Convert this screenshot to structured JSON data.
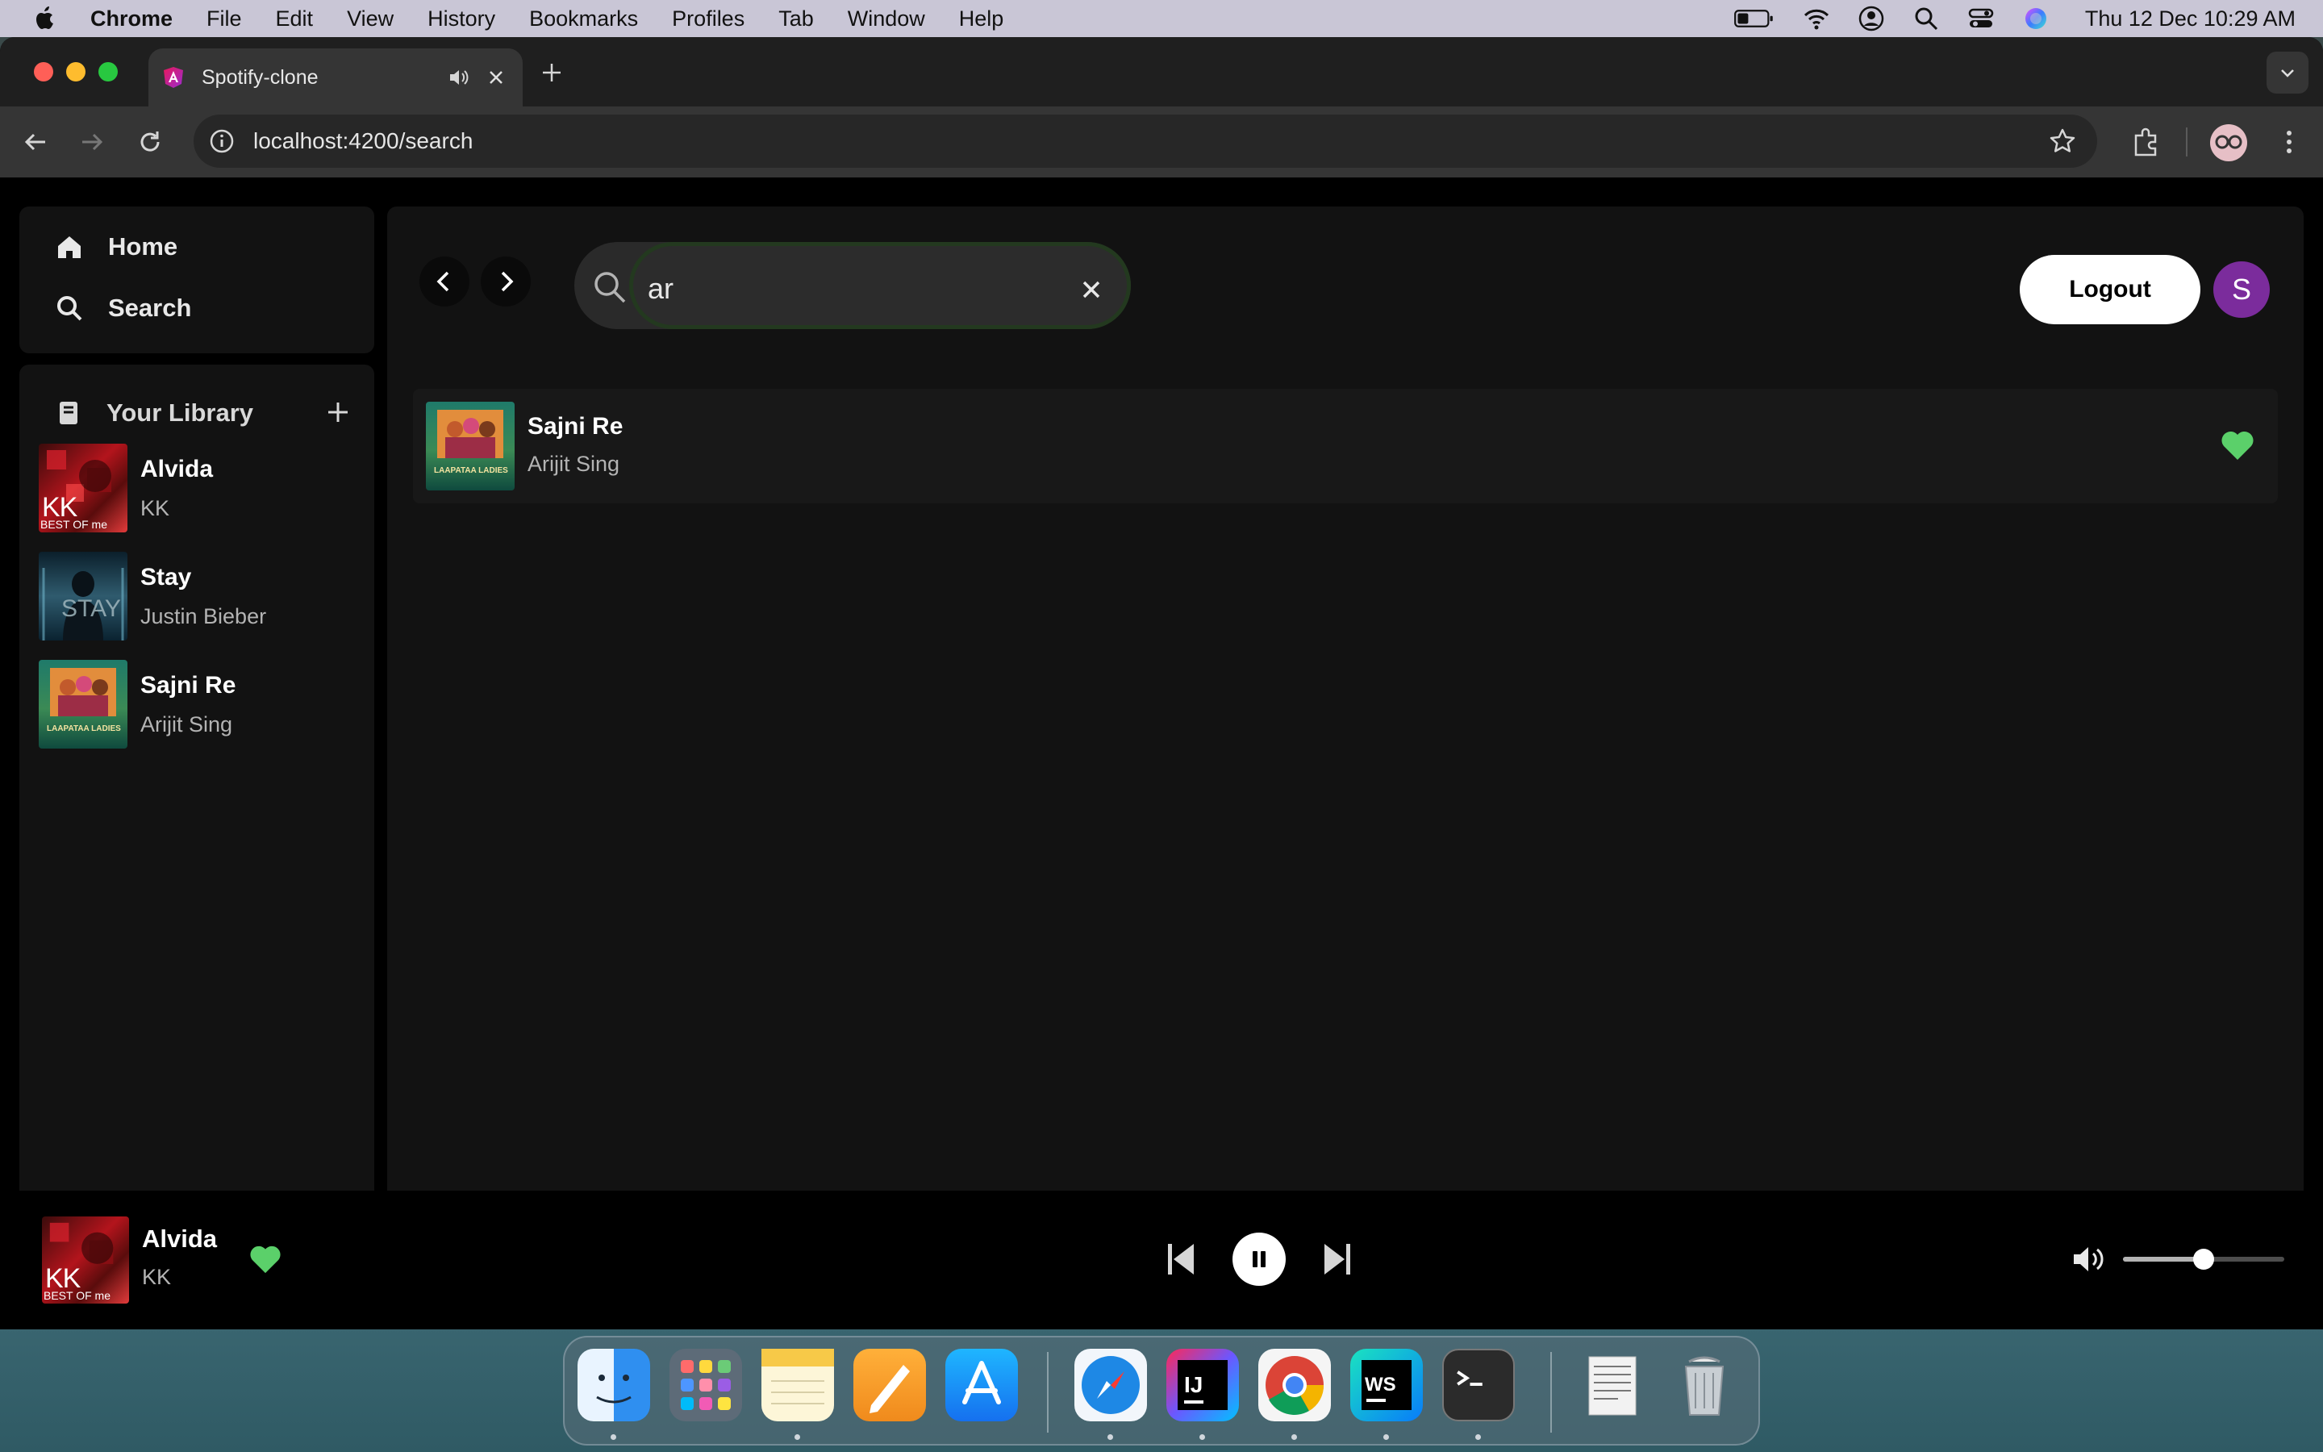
{
  "menubar": {
    "app": "Chrome",
    "items": [
      "File",
      "Edit",
      "View",
      "History",
      "Bookmarks",
      "Profiles",
      "Tab",
      "Window",
      "Help"
    ],
    "clock": "Thu 12 Dec  10:29 AM"
  },
  "browser": {
    "tab_title": "Spotify-clone",
    "url": "localhost:4200/search"
  },
  "sidebar": {
    "home_label": "Home",
    "search_label": "Search",
    "library_label": "Your Library",
    "library_items": [
      {
        "title": "Alvida",
        "artist": "KK",
        "cover_text": "KK",
        "cover_sub": "BEST OF me"
      },
      {
        "title": "Stay",
        "artist": "Justin Bieber",
        "cover_text": "STAY"
      },
      {
        "title": "Sajni Re",
        "artist": "Arijit Sing",
        "cover_text": "LAAPATAA LADIES"
      }
    ]
  },
  "main": {
    "search": {
      "value": "ar",
      "placeholder": ""
    },
    "logout_label": "Logout",
    "avatar_letter": "S",
    "results": [
      {
        "title": "Sajni Re",
        "artist": "Arijit Sing",
        "liked": true
      }
    ]
  },
  "player": {
    "title": "Alvida",
    "artist": "KK",
    "liked": true,
    "state": "playing",
    "volume": 0.5
  },
  "colors": {
    "accent_green": "#5bd06a",
    "panel_bg": "#121212",
    "avatar_purple": "#7b2c9c"
  }
}
